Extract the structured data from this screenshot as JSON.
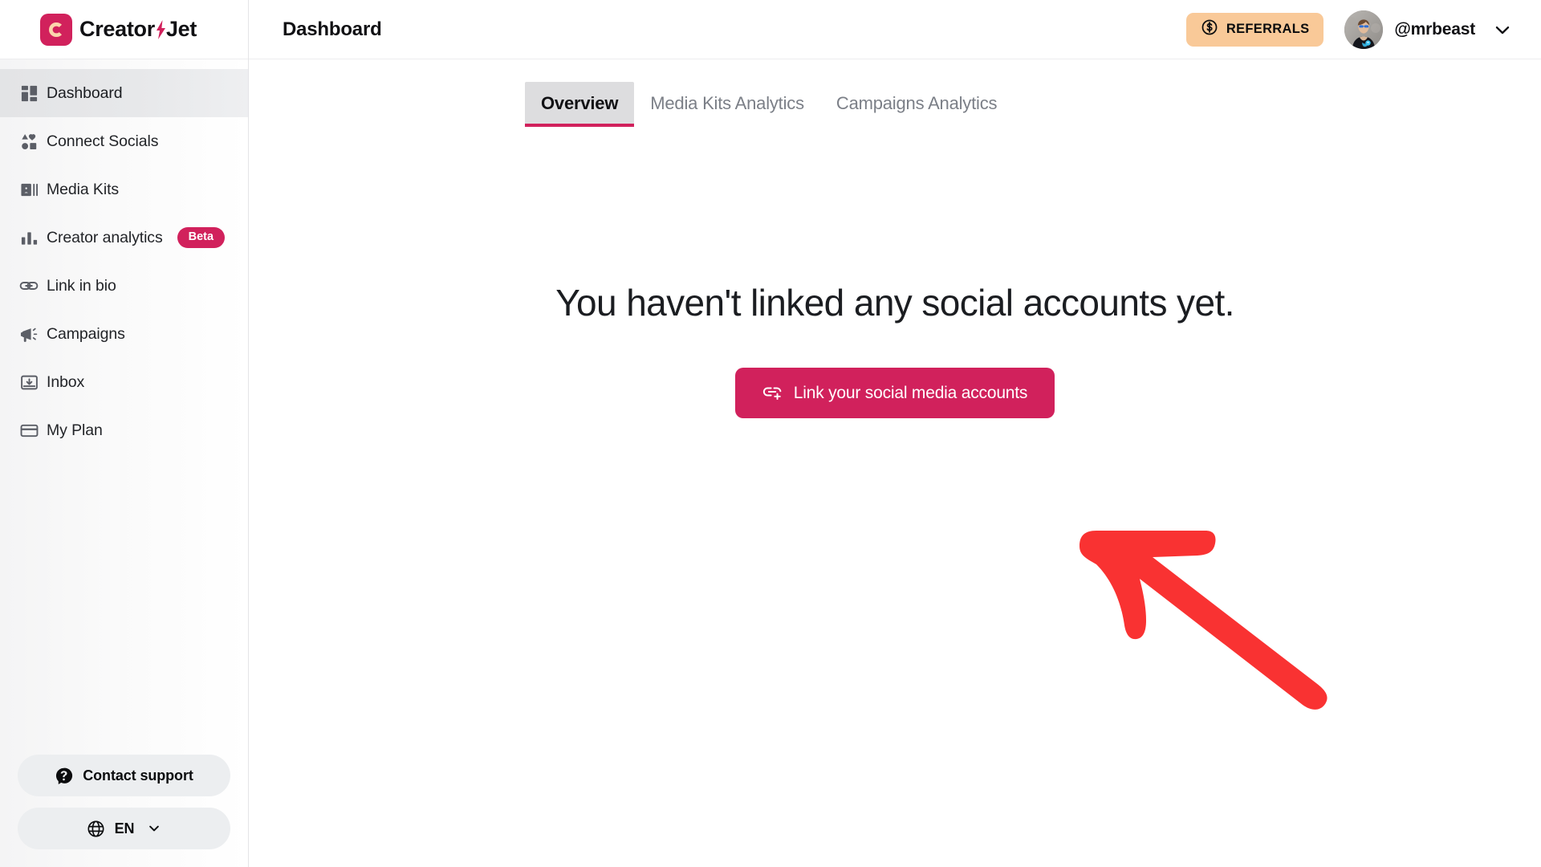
{
  "brand": {
    "logo_icon": "creatorjet-logo-mark",
    "name_part1": "Creator",
    "bolt_icon": "lightning-bolt-icon",
    "name_part2": "Jet",
    "mark_bg": "#d1215c",
    "mark_letter": "C",
    "mark_letter_color": "#fbd6ad"
  },
  "sidebar": {
    "items": [
      {
        "label": "Dashboard",
        "icon": "dashboard-grid-icon",
        "active": true,
        "badge": null
      },
      {
        "label": "Connect Socials",
        "icon": "shapes-icon",
        "active": false,
        "badge": null
      },
      {
        "label": "Media Kits",
        "icon": "media-kit-card-icon",
        "active": false,
        "badge": null
      },
      {
        "label": "Creator analytics",
        "icon": "bar-chart-icon",
        "active": false,
        "badge": "Beta"
      },
      {
        "label": "Link in bio",
        "icon": "link-chain-icon",
        "active": false,
        "badge": null
      },
      {
        "label": "Campaigns",
        "icon": "megaphone-icon",
        "active": false,
        "badge": null
      },
      {
        "label": "Inbox",
        "icon": "inbox-download-icon",
        "active": false,
        "badge": null
      },
      {
        "label": "My Plan",
        "icon": "credit-card-icon",
        "active": false,
        "badge": null
      }
    ],
    "footer": {
      "support_label": "Contact support",
      "support_icon": "question-mark-circle-icon",
      "language_label": "EN",
      "language_icon": "globe-icon",
      "language_chevron_icon": "chevron-down-icon"
    },
    "badge_color": "#d1215c"
  },
  "header": {
    "title": "Dashboard",
    "referrals_label": "REFERRALS",
    "referrals_icon": "dollar-coin-icon",
    "referrals_bg": "#f9c998",
    "user_name": "@mrbeast",
    "avatar_icon": "user-avatar-photo",
    "user_chevron_icon": "chevron-down-icon"
  },
  "tabs": [
    {
      "label": "Overview",
      "active": true
    },
    {
      "label": "Media Kits Analytics",
      "active": false
    },
    {
      "label": "Campaigns Analytics",
      "active": false
    }
  ],
  "tab_accent": "#d1215c",
  "main": {
    "empty_title": "You haven't linked any social accounts yet.",
    "cta_label": "Link your social media accounts",
    "cta_icon": "link-plus-icon",
    "cta_bg": "#d1215c"
  },
  "annotation": {
    "shape": "hand-drawn-arrow-pointing-up-left",
    "color": "#f93232"
  }
}
